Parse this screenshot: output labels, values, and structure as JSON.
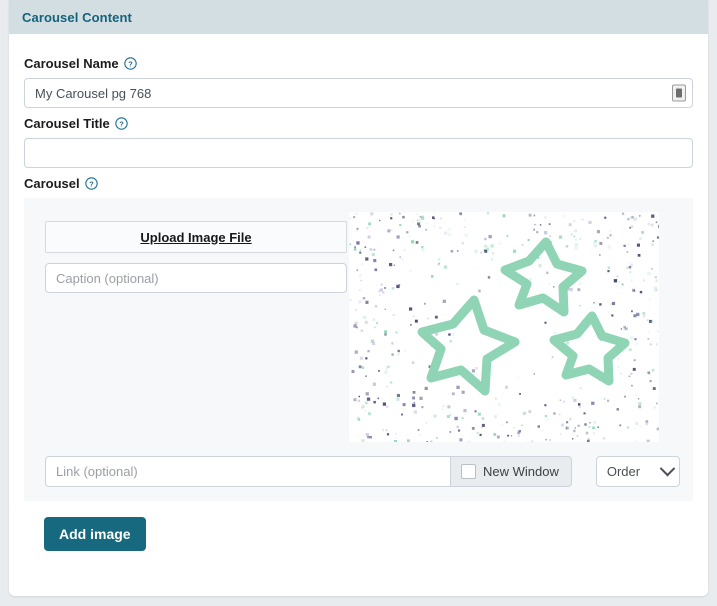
{
  "panel": {
    "header_title": "Carousel Content"
  },
  "fields": {
    "name": {
      "label": "Carousel Name",
      "help_icon": "help-circle-icon",
      "value": "My Carousel pg 768",
      "placeholder": "",
      "autofill_icon": "autofill-indicator-icon"
    },
    "title": {
      "label": "Carousel Title",
      "help_icon": "help-circle-icon",
      "value": "",
      "placeholder": ""
    },
    "carousel": {
      "label": "Carousel",
      "help_icon": "help-circle-icon"
    }
  },
  "item": {
    "upload_label": "Upload Image File",
    "caption_placeholder": "Caption (optional)",
    "caption_value": "",
    "link_placeholder": "Link (optional)",
    "link_value": "",
    "new_window_label": "New Window",
    "new_window_checked": false,
    "order_label": "Order",
    "preview_alt": "stars-placeholder-image"
  },
  "actions": {
    "add_image_label": "Add image"
  },
  "colors": {
    "header_bg": "#d3dee3",
    "header_text": "#15637a",
    "accent_button": "#16697e",
    "panel_bg": "#f6f8f9",
    "star_stroke": "#8fd4b4",
    "help_icon": "#1a6d8c"
  }
}
